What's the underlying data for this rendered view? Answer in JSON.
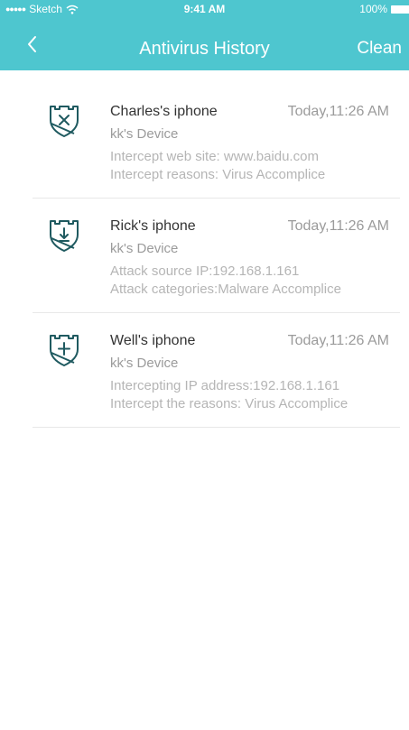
{
  "status_bar": {
    "carrier": "Sketch",
    "time": "9:41 AM",
    "battery": "100%"
  },
  "nav": {
    "title": "Antivirus History",
    "action_label": "Clean",
    "back_icon": "chevron-left-icon"
  },
  "colors": {
    "header_bg": "#4ec6cf",
    "icon_stroke": "#1f5a60"
  },
  "history": [
    {
      "icon": "shield-x-icon",
      "name": "Charles's iphone",
      "time": "Today,11:26 AM",
      "device": "kk's Device",
      "detail1": "Intercept web site: www.baidu.com",
      "detail2": "Intercept reasons: Virus Accomplice"
    },
    {
      "icon": "shield-download-icon",
      "name": "Rick's iphone",
      "time": "Today,11:26 AM",
      "device": "kk's Device",
      "detail1": "Attack source IP:192.168.1.161",
      "detail2": "Attack categories:Malware Accomplice"
    },
    {
      "icon": "shield-plus-icon",
      "name": "Well's iphone",
      "time": "Today,11:26 AM",
      "device": "kk's Device",
      "detail1": "Intercepting IP address:192.168.1.161",
      "detail2": "Intercept the reasons: Virus Accomplice"
    }
  ]
}
